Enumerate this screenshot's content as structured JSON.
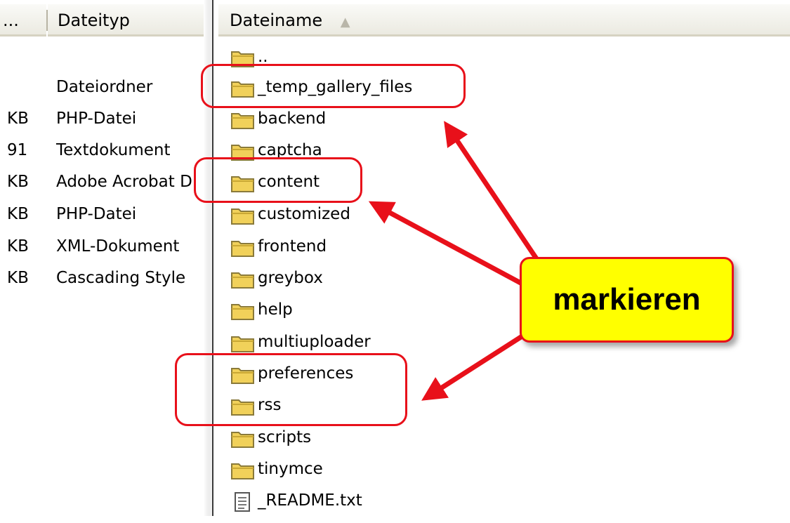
{
  "columns": {
    "size_header": "...",
    "type_header": "Dateityp",
    "name_header": "Dateiname",
    "sort_indicator": "▲"
  },
  "left_rows": [
    {
      "size": "",
      "type": ""
    },
    {
      "size": "",
      "type": "Dateiordner"
    },
    {
      "size": "KB",
      "type": "PHP-Datei"
    },
    {
      "size": "91",
      "type": "Textdokument"
    },
    {
      "size": "KB",
      "type": "Adobe Acrobat D"
    },
    {
      "size": "KB",
      "type": "PHP-Datei"
    },
    {
      "size": "KB",
      "type": "XML-Dokument"
    },
    {
      "size": "KB",
      "type": "Cascading Style"
    }
  ],
  "files": [
    {
      "name": "..",
      "icon": "folder-icon"
    },
    {
      "name": "_temp_gallery_files",
      "icon": "folder-icon"
    },
    {
      "name": "backend",
      "icon": "folder-icon"
    },
    {
      "name": "captcha",
      "icon": "folder-icon"
    },
    {
      "name": "content",
      "icon": "folder-icon"
    },
    {
      "name": "customized",
      "icon": "folder-icon"
    },
    {
      "name": "frontend",
      "icon": "folder-icon"
    },
    {
      "name": "greybox",
      "icon": "folder-icon"
    },
    {
      "name": "help",
      "icon": "folder-icon"
    },
    {
      "name": "multiuploader",
      "icon": "folder-icon"
    },
    {
      "name": "preferences",
      "icon": "folder-icon"
    },
    {
      "name": "rss",
      "icon": "folder-icon"
    },
    {
      "name": "scripts",
      "icon": "folder-icon"
    },
    {
      "name": "tinymce",
      "icon": "folder-icon"
    },
    {
      "name": "_README.txt",
      "icon": "text-file-icon"
    }
  ],
  "annotation": {
    "label": "markieren",
    "highlighted": [
      "_temp_gallery_files",
      "content",
      "preferences",
      "rss"
    ],
    "badge_color": "#ffff00",
    "highlight_color": "#e8101a"
  },
  "colors": {
    "folder_body": "#f1d15a",
    "folder_outline": "#8a7a3a",
    "header_bg": "#ebeae1"
  }
}
